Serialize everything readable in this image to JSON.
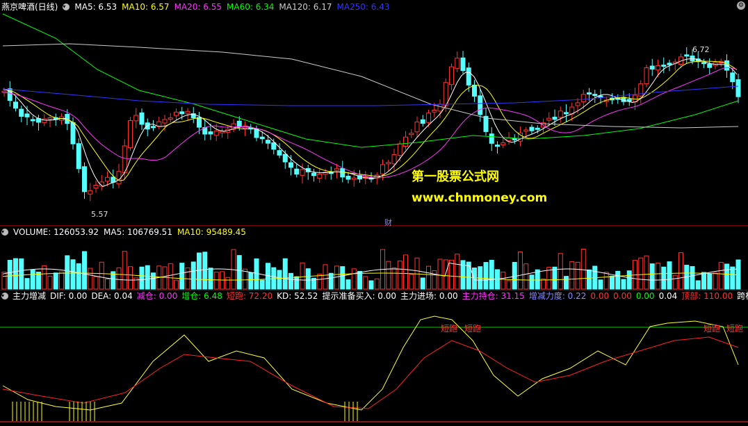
{
  "main_header": {
    "title": "燕京啤酒(日线)",
    "indicators": [
      {
        "label": "MA5: 6.53",
        "color": "#ffffff"
      },
      {
        "label": "MA10: 6.57",
        "color": "#ffff00"
      },
      {
        "label": "MA20: 6.55",
        "color": "#ff33ff"
      },
      {
        "label": "MA60: 6.34",
        "color": "#00ff00"
      },
      {
        "label": "MA120: 6.17",
        "color": "#cccccc"
      },
      {
        "label": "MA250: 6.43",
        "color": "#3333ff"
      }
    ]
  },
  "price_labels": {
    "high": "6.72",
    "low": "5.57",
    "marker": "财"
  },
  "watermark": {
    "line1": "第一股票公式网",
    "line2": "www.chnmoney.com"
  },
  "volume_header": {
    "items": [
      {
        "label": "VOLUME: 126053.92",
        "color": "#ffffff"
      },
      {
        "label": "MA5: 106769.51",
        "color": "#ffffff"
      },
      {
        "label": "MA10: 95489.45",
        "color": "#ffff00"
      }
    ]
  },
  "indicator_header": {
    "name": "主力增减",
    "items": [
      {
        "label": "DIF: 0.00",
        "color": "#ffffff"
      },
      {
        "label": "DEA: 0.04",
        "color": "#ffffff"
      },
      {
        "label": "减仓: 0.00",
        "color": "#ff33ff"
      },
      {
        "label": "增仓: 6.48",
        "color": "#00ff00"
      },
      {
        "label": "短跑: 72.20",
        "color": "#ff3333"
      },
      {
        "label": "KD: 52.52",
        "color": "#ffffff"
      },
      {
        "label": "提示准备买入: 0.00",
        "color": "#ffffff"
      },
      {
        "label": "主力进场: 0.00",
        "color": "#ffffff"
      },
      {
        "label": "主力持仓: 31.15",
        "color": "#ff33ff"
      },
      {
        "label": "增减力度: 0.22",
        "color": "#8888ff"
      },
      {
        "label": "0.00",
        "color": "#ff3333"
      },
      {
        "label": "0.00",
        "color": "#ff3333"
      },
      {
        "label": "0.00",
        "color": "#00ff00"
      },
      {
        "label": "0.04",
        "color": "#ffffff"
      },
      {
        "label": "顶部: 110.00",
        "color": "#ff3333"
      },
      {
        "label": "跨栏",
        "color": "#ffffff"
      }
    ],
    "signal_label": "短跑"
  },
  "colors": {
    "up": "#ff3232",
    "down": "#54ffff",
    "ma5": "#ffffff",
    "ma10": "#ffff00",
    "ma20": "#ff33ff",
    "ma60": "#00ff00",
    "ma120": "#cccccc",
    "ma250": "#3333ff"
  }
}
